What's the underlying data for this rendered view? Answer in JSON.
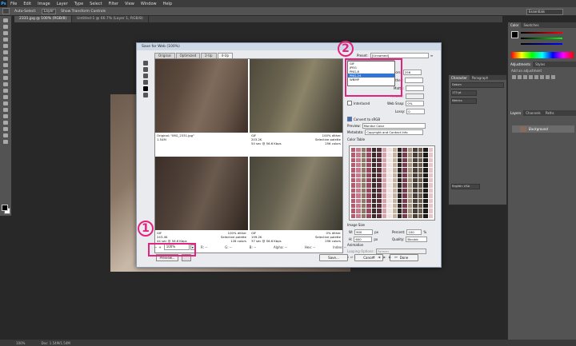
{
  "app": {
    "logo": "Ps",
    "menu": [
      "File",
      "Edit",
      "Image",
      "Layer",
      "Type",
      "Select",
      "Filter",
      "View",
      "Window",
      "Help"
    ],
    "options": {
      "auto_select": "Auto-Select:",
      "layer": "Layer",
      "transform": "Show Transform Controls"
    },
    "workspace": "Essentials"
  },
  "doc_tabs": [
    "2331.jpg @ 100% (RGB/8)",
    "Untitled-1 @ 66.7% (Layer 1, RGB/8)"
  ],
  "status": {
    "zoom": "100%",
    "doc": "Doc: 1.54M/1.54M"
  },
  "panels": {
    "color_tabs": [
      "Color",
      "Swatches"
    ],
    "adjust_tabs": [
      "Adjustments",
      "Styles"
    ],
    "adjust_label": "Add an adjustment",
    "layer_tabs": [
      "Layers",
      "Channels",
      "Paths"
    ],
    "layer_name": "Background",
    "char_tabs": [
      "Character",
      "Paragraph"
    ],
    "char_font": "Dotum",
    "char_size": "173 pt",
    "char_metrics": "Metrics",
    "char_lang": "English: USA",
    "char_aa": "Smooth"
  },
  "dialog": {
    "title": "Save for Web (100%)",
    "view_tabs": [
      "Original",
      "Optimized",
      "2-Up",
      "4-Up"
    ],
    "cells": [
      {
        "left": "Original: \"IMG_2331.jpg\"\n1.54M",
        "right": ""
      },
      {
        "left": "GIF\n203.2K\n54 sec @ 56.6 Kbps",
        "right": "100% dither\nSelective palette\n256 colors"
      },
      {
        "left": "GIF\n243.4K\n44 sec @ 56.6 Kbps",
        "right": "100% dither\nSelective palette\n128 colors"
      },
      {
        "left": "GIF\n199.2K\n37 sec @ 56.6 Kbps",
        "right": "0% dither\nSelective palette\n256 colors"
      }
    ],
    "zoom": "100%",
    "readouts": [
      "R: --",
      "G: --",
      "B: --",
      "Alpha: --",
      "Hex: --",
      "Index: --"
    ],
    "buttons": {
      "preview": "Preview...",
      "save": "Save...",
      "cancel": "Cancel",
      "done": "Done"
    },
    "settings": {
      "preset_label": "Preset:",
      "preset_value": "[Unnamed]",
      "format_value": "GIF",
      "format_options": [
        "GIF",
        "JPEG",
        "PNG-8",
        "PNG-24",
        "WBMP"
      ],
      "colors_label": "Colors:",
      "colors_value": "256",
      "dither_label": "Dither:",
      "matte_label": "Matte:",
      "amount_label": "Amount:",
      "interlaced_label": "Interlaced",
      "websnap_label": "Web Snap:",
      "websnap_value": "0%",
      "lossy_label": "Lossy:",
      "lossy_value": "0",
      "convert_label": "Convert to sRGB",
      "preview_label": "Preview:",
      "preview_value": "Monitor Color",
      "metadata_label": "Metadata:",
      "metadata_value": "Copyright and Contact Info",
      "colortable_label": "Color Table",
      "imagesize_label": "Image Size",
      "w_label": "W:",
      "w_value": "900",
      "h_label": "H:",
      "h_value": "600",
      "px": "px",
      "percent_label": "Percent:",
      "percent_value": "100",
      "pct": "%",
      "quality_label": "Quality:",
      "quality_value": "Bicubic",
      "animation_label": "Animation",
      "looping_label": "Looping Options:",
      "looping_value": "Forever",
      "frame_counter": "1 of 1"
    }
  },
  "annotations": [
    {
      "label": "1"
    },
    {
      "label": "2"
    }
  ],
  "colors": {
    "highlight": "#e4237e",
    "selection": "#3375d6"
  }
}
